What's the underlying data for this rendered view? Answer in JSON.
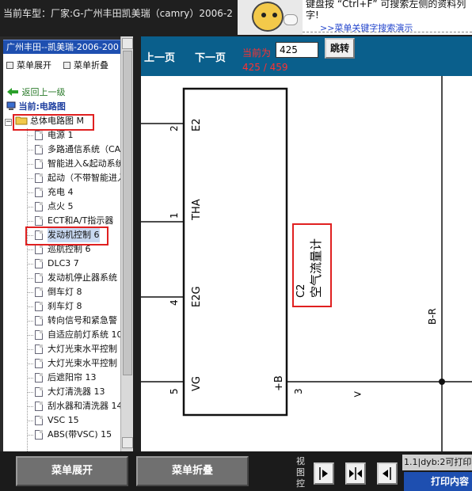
{
  "header": {
    "car_type": "当前车型：厂家:G-广州丰田凯美瑞（camry）2006-2",
    "tip_line1": "键盘按 “Ctrl+F” 可搜索左侧的资料列",
    "tip_line2": "字!",
    "tip_link": ">>菜单关键字搜索演示"
  },
  "left_panel": {
    "title": "广州丰田--凯美瑞-2006-200",
    "expand_label": "菜单展开",
    "collapse_label": "菜单折叠",
    "back_label": "返回上一级",
    "current_label": "当前:电路图",
    "root_label": "总体电路图 M",
    "items": [
      "电源 1",
      "多路通信系统（CA",
      "智能进入&起动系统",
      "起动（不带智能进入",
      "充电 4",
      "点火 5",
      "ECT和A/T指示器",
      "发动机控制 6",
      "巡航控制 6",
      "DLC3 7",
      "发动机停止器系统",
      "倒车灯 8",
      "刹车灯 8",
      "转向信号和紧急警",
      "自适应前灯系统 10",
      "大灯光束水平控制",
      "大灯光束水平控制",
      "后遮阳帘 13",
      "大灯清洗器 13",
      "刮水器和清洗器 14",
      "VSC 15",
      "ABS(带VSC) 15"
    ]
  },
  "nav": {
    "prev_label": "上一页",
    "next_label": "下一页",
    "current_label": "当前为",
    "page_value": "425",
    "jump_label": "跳转",
    "page_count": "425 / 459"
  },
  "diagram": {
    "connector_id": "C2",
    "component_name": "空气流量计",
    "pins": [
      {
        "num": "2",
        "name": "E2"
      },
      {
        "num": "1",
        "name": "THA"
      },
      {
        "num": "4",
        "name": "E2G"
      },
      {
        "num": "5",
        "name": "VG"
      },
      {
        "num": "3",
        "name": "+B"
      }
    ],
    "wire_label": "B-R",
    "arrow_label": ">"
  },
  "bottom": {
    "expand_label": "菜单展开",
    "collapse_label": "菜单折叠",
    "view_label": "视图控",
    "status_text": "1.1|dyb:2可打印",
    "print_label": "打印内容"
  },
  "colors": {
    "nav_bg": "#0a5f8c",
    "highlight_red": "#e02020",
    "title_blue": "#1e4fb0",
    "page_red": "#ff3030"
  }
}
